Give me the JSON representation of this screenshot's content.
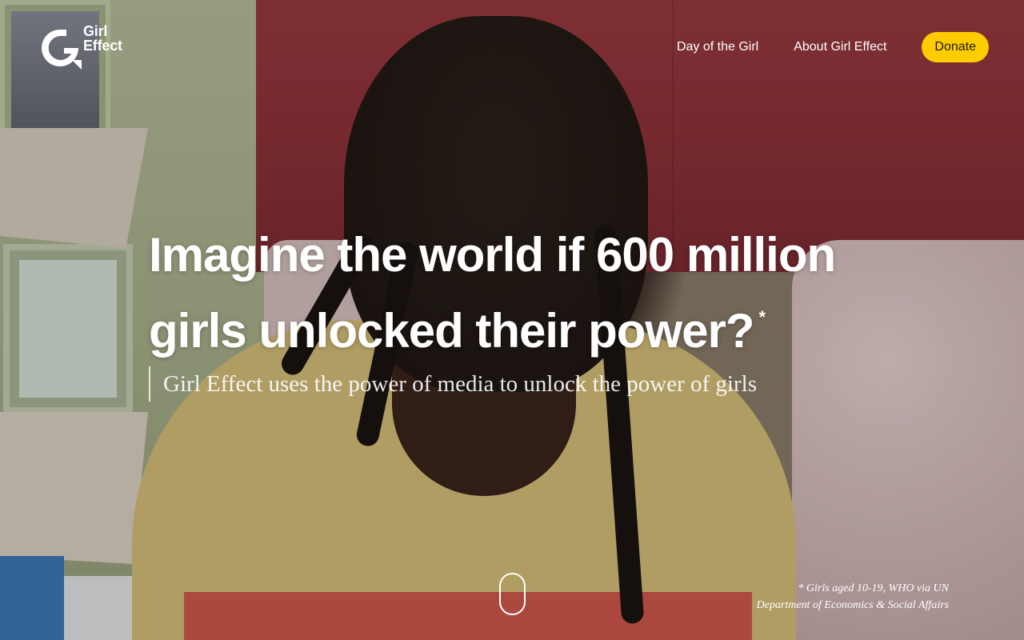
{
  "brand": {
    "logo_text_line1": "Girl",
    "logo_text_line2": "Effect"
  },
  "nav": {
    "items": [
      {
        "label": "Day of the Girl"
      },
      {
        "label": "About Girl Effect"
      }
    ],
    "donate_label": "Donate",
    "donate_color": "#ffcc00"
  },
  "hero": {
    "headline_line1": "Imagine the world if 600 million",
    "headline_line2": "girls unlocked their power?",
    "asterisk": "*",
    "subheadline": "Girl Effect uses the power of media to unlock the power of girls",
    "footnote_line1": "* Girls aged 10-19, WHO via UN",
    "footnote_line2": "Department of Economics & Social Affairs"
  }
}
